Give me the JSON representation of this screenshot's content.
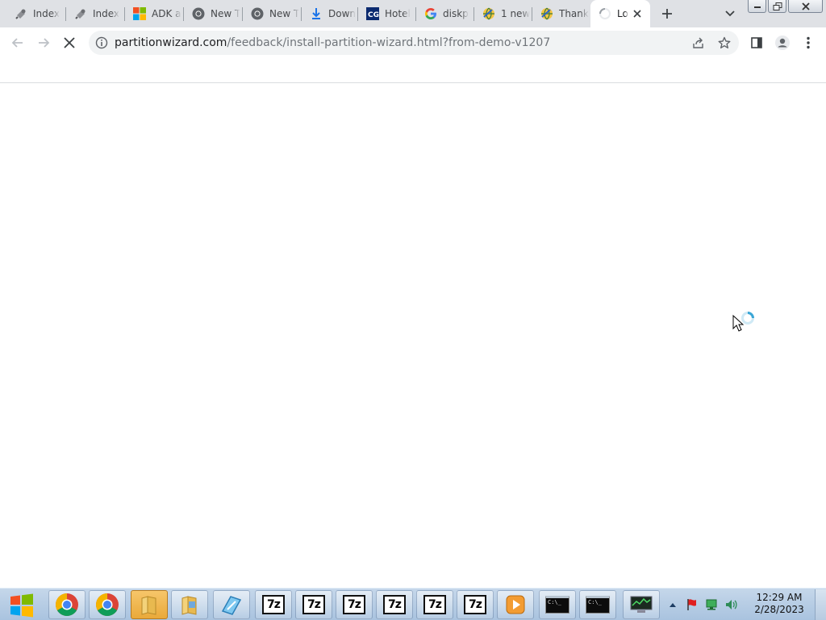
{
  "browser": {
    "tabs": [
      {
        "label": "Index",
        "icon": "script-icon"
      },
      {
        "label": "Index",
        "icon": "script-icon"
      },
      {
        "label": "ADK a",
        "icon": "microsoft-logo-icon"
      },
      {
        "label": "New T",
        "icon": "chrome-icon"
      },
      {
        "label": "New T",
        "icon": "chrome-icon"
      },
      {
        "label": "Down",
        "icon": "download-icon"
      },
      {
        "label": "Hotel",
        "icon": "hotel-icon"
      },
      {
        "label": "diskp",
        "icon": "google-icon"
      },
      {
        "label": "1 new",
        "icon": "globe-icon"
      },
      {
        "label": "Thank",
        "icon": "globe-icon"
      },
      {
        "label": "Lo",
        "icon": "loading-icon"
      }
    ],
    "url_host": "partitionwizard.com",
    "url_path": "/feedback/install-partition-wizard.html?from-demo-v1207"
  },
  "taskbar": {
    "apps": [
      "chrome",
      "chrome",
      "folder",
      "folder",
      "setup",
      "7z",
      "7z",
      "7z",
      "7z",
      "7z",
      "7z",
      "media-player",
      "cmd",
      "cmd",
      "network-monitor"
    ],
    "cmd_text": "C:\\_",
    "time": "12:29 AM",
    "date": "2/28/2023"
  },
  "colors": {
    "tabstrip": "#dfe1e5",
    "omnibox": "#f1f3f4",
    "taskbar": "#b8cde4"
  }
}
